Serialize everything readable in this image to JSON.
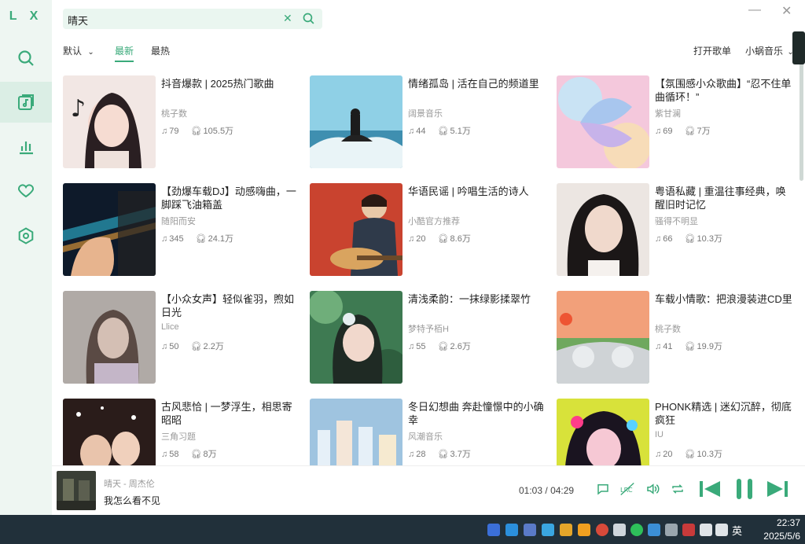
{
  "app": {
    "logo": "L X"
  },
  "sidebar": {
    "items": [
      {
        "name": "search",
        "icon": "search-icon"
      },
      {
        "name": "songlist",
        "icon": "music-note-box-icon",
        "active": true
      },
      {
        "name": "leaderboard",
        "icon": "bar-chart-icon"
      },
      {
        "name": "favorites",
        "icon": "heart-icon"
      },
      {
        "name": "settings",
        "icon": "hexagon-settings-icon"
      }
    ]
  },
  "search": {
    "value": "晴天",
    "clear_icon": "close-icon",
    "submit_icon": "search-icon"
  },
  "window": {
    "minimize": "—",
    "close": "✕"
  },
  "filters": {
    "sort_label": "默认",
    "tabs": [
      {
        "label": "最新",
        "active": true
      },
      {
        "label": "最热",
        "active": false
      }
    ],
    "open_list_label": "打开歌单",
    "source_label": "小蜗音乐"
  },
  "playlists": [
    {
      "title": "抖音爆款 | 2025热门歌曲",
      "author": "桃子数",
      "songs": "79",
      "plays": "105.5万"
    },
    {
      "title": "情绪孤岛 | 活在自己的频道里",
      "author": "阔景音乐",
      "songs": "44",
      "plays": "5.1万"
    },
    {
      "title": "【氛围感小众歌曲】“忍不住单曲循环！”",
      "author": "紫甘澜",
      "songs": "69",
      "plays": "7万"
    },
    {
      "title": "【劲爆车载DJ】动感嗨曲，一脚踩飞油箱盖",
      "author": "随阳而安",
      "songs": "345",
      "plays": "24.1万"
    },
    {
      "title": "华语民谣 | 吟唱生活的诗人",
      "author": "小酷官方推荐",
      "songs": "20",
      "plays": "8.6万"
    },
    {
      "title": "粤语私藏 | 重温往事经典，唤醒旧时记忆",
      "author": "骚得不明显",
      "songs": "66",
      "plays": "10.3万"
    },
    {
      "title": "【小众女声】轻似雀羽，煦如日光",
      "author": "Llice",
      "songs": "50",
      "plays": "2.2万"
    },
    {
      "title": "清浅柔韵：一抹绿影揉翠竹",
      "author": "梦特予栢H",
      "songs": "55",
      "plays": "2.6万"
    },
    {
      "title": "车载小情歌：把浪漫装进CD里",
      "author": "桃子数",
      "songs": "41",
      "plays": "19.9万"
    },
    {
      "title": "古风悲恰 | 一梦浮生，相思寄昭昭",
      "author": "三角习题",
      "songs": "58",
      "plays": "8万"
    },
    {
      "title": "冬日幻想曲 奔赴憧憬中的小确幸",
      "author": "风潮音乐",
      "songs": "28",
      "plays": "3.7万"
    },
    {
      "title": "PHONK精选 | 迷幻沉醉，彻底疯狂",
      "author": "IU",
      "songs": "20",
      "plays": "10.3万"
    }
  ],
  "player": {
    "song": "晴天 - 周杰伦",
    "lyric": "我怎么看不见",
    "time_current": "01:03",
    "time_sep": "/",
    "time_total": "04:29",
    "buttons": [
      "comment-icon",
      "lrc-icon",
      "volume-icon",
      "repeat-icon",
      "prev-icon",
      "pause-icon",
      "next-icon"
    ]
  },
  "taskbar": {
    "lang": "英",
    "time": "22:37",
    "date": "2025/5/6"
  },
  "colors": {
    "accent": "#3aaa7a",
    "sidebar_bg": "#eef6f2",
    "search_bg": "#eaf6f0",
    "taskbar_bg": "#21303a"
  }
}
